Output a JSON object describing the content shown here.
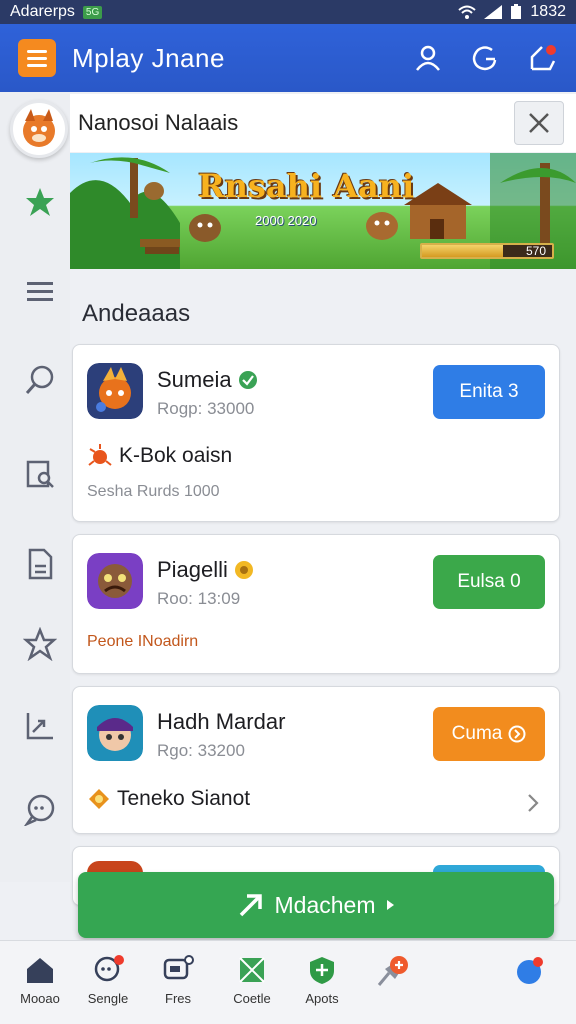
{
  "status_bar": {
    "carrier": "Adarerps",
    "sim_badge": "5G",
    "time": "1832"
  },
  "app_bar": {
    "title": "Mplay Jnane",
    "actions": [
      "user-icon",
      "refresh-icon",
      "edit-icon"
    ]
  },
  "search": {
    "value": "Nanosoi Nalaais"
  },
  "banner": {
    "title": "Rnsahi Aani",
    "subtitle": "2000 2020",
    "progress_text": "570",
    "progress": 0.62
  },
  "section": {
    "title": "Andeaaas"
  },
  "cards": [
    {
      "name": "Sumeia",
      "subtitle": "Rogp: 33000",
      "button": "Enita 3",
      "button_color": "#2f7de6",
      "feature": "K-Bok oaisn",
      "footer": "Sesha Rurds 1000"
    },
    {
      "name": "Piagelli",
      "subtitle": "Roo: 13:09",
      "button": "Eulsa 0",
      "button_color": "#3ba84a",
      "footer": "Peone INoadirn",
      "footer_color": "#c2571c"
    },
    {
      "name": "Hadh Mardar",
      "subtitle": "Rgo: 33200",
      "button": "Cuma",
      "button_color": "#f28c1e",
      "feature": "Teneko Sianot"
    }
  ],
  "fab": {
    "label": "Mdachem"
  },
  "bottom_nav": [
    {
      "label": "Mooao",
      "icon": "home-icon"
    },
    {
      "label": "Sengle",
      "icon": "chat-icon"
    },
    {
      "label": "Fres",
      "icon": "message-icon"
    },
    {
      "label": "Coetle",
      "icon": "box-icon"
    },
    {
      "label": "Apots",
      "icon": "shield-icon"
    },
    {
      "label": "",
      "icon": "pin-icon"
    },
    {
      "label": "",
      "icon": "dot-icon"
    }
  ],
  "colors": {
    "primary": "#2f62d9",
    "accent": "#f58a1f",
    "green": "#35a652"
  }
}
